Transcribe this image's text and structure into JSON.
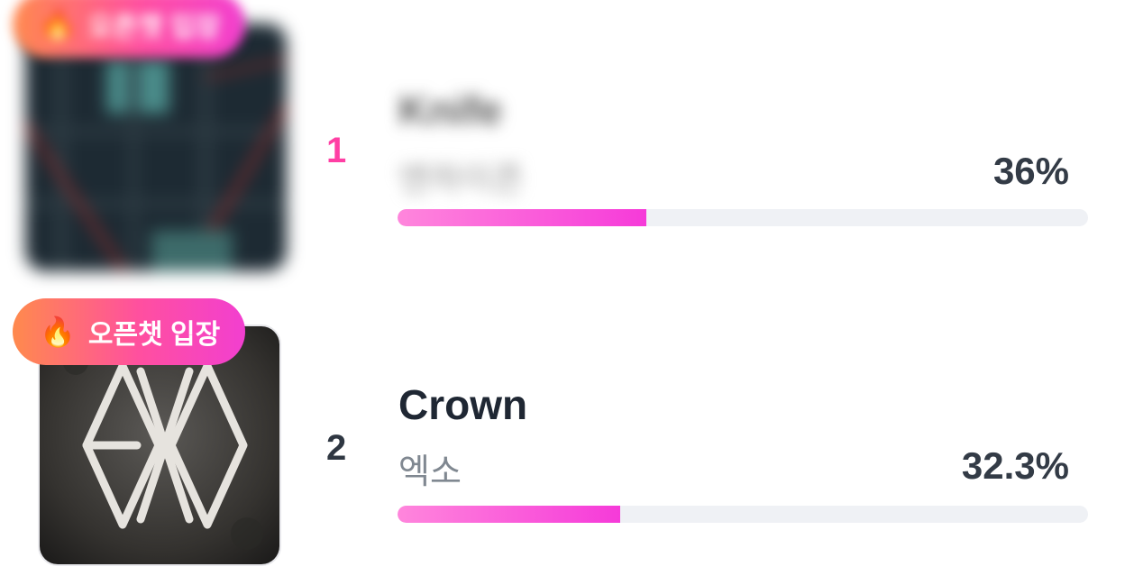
{
  "ranking": [
    {
      "rank": "1",
      "title": "Knife",
      "artist": "엔하이픈",
      "percent_label": "36%",
      "percent": 0.36,
      "badge": {
        "icon": "fire-icon",
        "emoji": "🔥",
        "label": "오픈챗 입장"
      },
      "blurred": true
    },
    {
      "rank": "2",
      "title": "Crown",
      "artist": "엑소",
      "percent_label": "32.3%",
      "percent": 0.323,
      "badge": {
        "icon": "fire-icon",
        "emoji": "🔥",
        "label": "오픈챗 입장"
      },
      "blurred": false
    }
  ],
  "colors": {
    "accent_pink": "#f63ad9",
    "rank1": "#ff3fa4",
    "track": "#eff1f5",
    "badge_start": "#ff8a4d",
    "badge_end": "#f23fd0"
  }
}
